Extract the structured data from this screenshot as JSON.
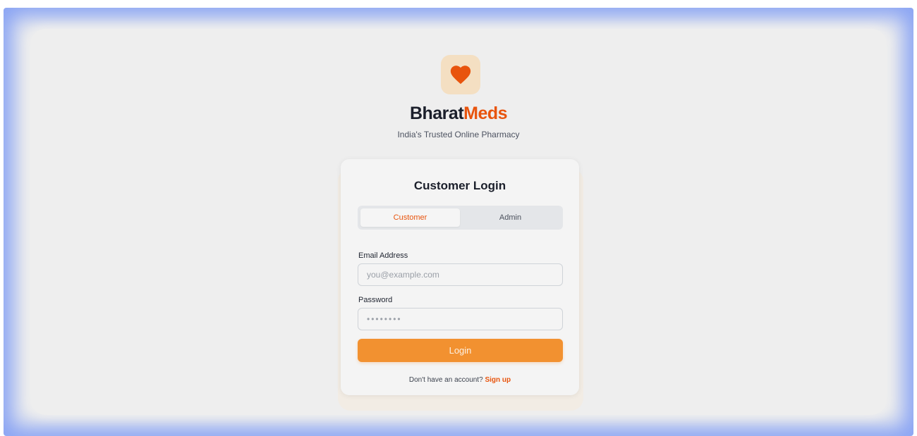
{
  "brand": {
    "name_part1": "Bharat",
    "name_part2": "Meds",
    "tagline": "India's Trusted Online Pharmacy",
    "logo_icon": "heart-icon",
    "accent_color": "#e8540d",
    "logo_bg_color": "#f4dfc2"
  },
  "login_card": {
    "title": "Customer Login",
    "tabs": [
      {
        "label": "Customer",
        "active": true
      },
      {
        "label": "Admin",
        "active": false
      }
    ],
    "email": {
      "label": "Email Address",
      "placeholder": "you@example.com",
      "value": ""
    },
    "password": {
      "label": "Password",
      "placeholder": "••••••••",
      "value": ""
    },
    "login_label": "Login",
    "login_color": "#f29130",
    "signup_prompt": "Don't have an account?",
    "signup_link": "Sign up"
  }
}
